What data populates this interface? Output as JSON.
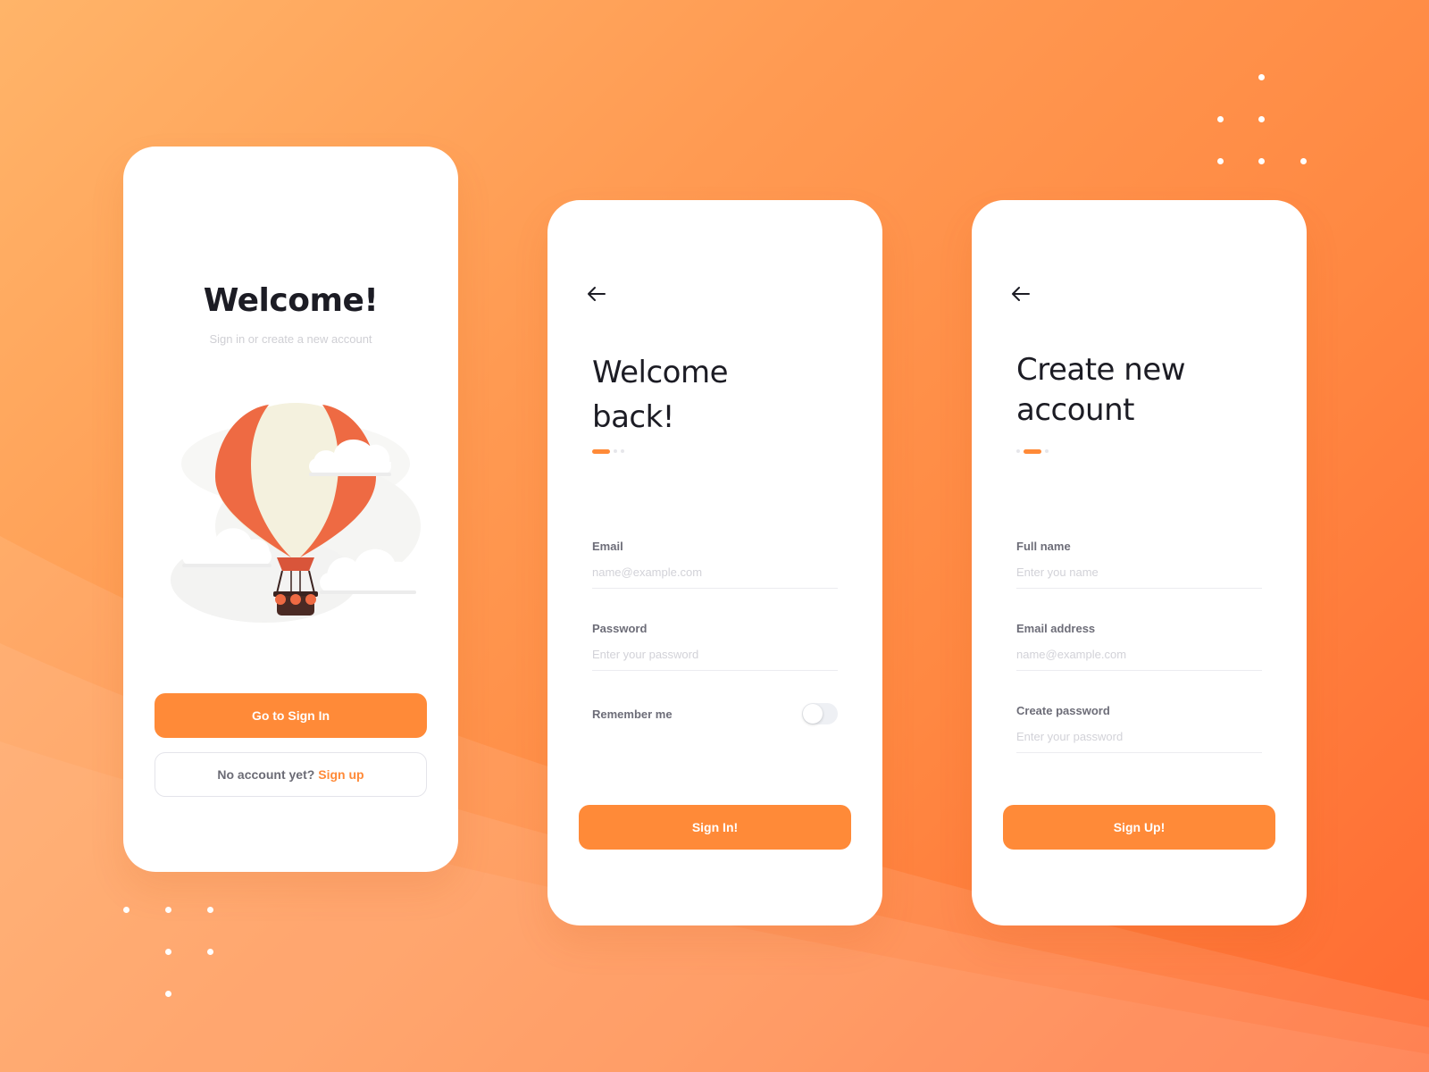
{
  "welcome_card": {
    "title": "Welcome!",
    "subtitle": "Sign in or create a new account",
    "signin_button": "Go to Sign In",
    "no_account_text": "No account yet?",
    "signup_link": "Sign up",
    "illustration": "hot-air-balloon-with-clouds"
  },
  "signin_card": {
    "back_icon": "arrow-left-icon",
    "title_line1": "Welcome",
    "title_line2": "back!",
    "step_indicator": {
      "active_index": 0,
      "count": 3
    },
    "email_label": "Email",
    "email_placeholder": "name@example.com",
    "password_label": "Password",
    "password_placeholder": "Enter your password",
    "remember_label": "Remember me",
    "remember_on": false,
    "submit_button": "Sign In!"
  },
  "signup_card": {
    "back_icon": "arrow-left-icon",
    "title_line1": "Create new",
    "title_line2": "account",
    "step_indicator": {
      "active_index": 1,
      "count": 3
    },
    "name_label": "Full name",
    "name_placeholder": "Enter you name",
    "email_label": "Email address",
    "email_placeholder": "name@example.com",
    "password_label": "Create password",
    "password_placeholder": "Enter your password",
    "submit_button": "Sign Up!"
  },
  "colors": {
    "accent": "#ff8a38",
    "background_start": "#ffb469",
    "background_end": "#ff6a32",
    "title_text": "#1c1c24",
    "label_text": "#6d6d78"
  }
}
